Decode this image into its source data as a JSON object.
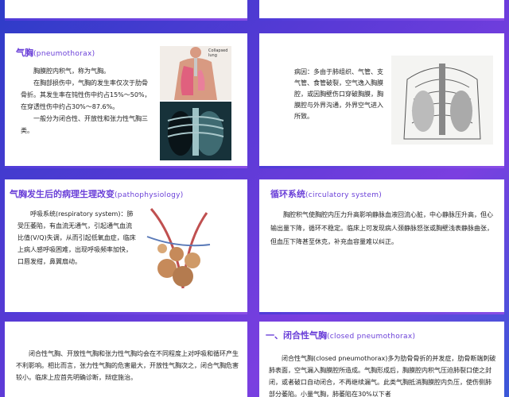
{
  "slide1": {
    "title_cn": "气胸",
    "title_en": "(pneumothorax)",
    "paragraphs": [
      "胸膜腔内积气，称为气胸。",
      "在胸部损伤中，气胸的发生率仅次于肋骨骨折。其发生率在钝性伤中约占15%～50%，在穿透性伤中约占30%～87.6%。",
      "一般分为闭合性、开放性和张力性气胸三类。"
    ],
    "figure_label": "Collapsed lung"
  },
  "slide2": {
    "text": "病因：多由于肺组织、气管、支气管、食管破裂，空气逸入胸膜腔，或因胸壁伤口穿破胸膜，胸膜腔与外界沟通，外界空气进入所致。"
  },
  "slide3": {
    "title_cn": "气胸发生后的病理生理改变",
    "title_en": "(pathophysiology)",
    "text": "呼吸系统(respiratory system)：肺受压萎陷，有血流无通气，引起通气血流比值(V/Q)失调，从而引起低氧血症，临床上病人感呼吸困难，出现呼吸频率加快，口唇发绀，鼻翼扇动。"
  },
  "slide4": {
    "title_cn": "循环系统",
    "title_en": "(circulatory system)",
    "text": "胸腔积气使胸腔内压力升高影响静脉血液回流心脏，中心静脉压升高，但心输出量下降，循环不稳定。临床上可发现病人颈静脉怒张或胸壁浅表静脉曲张，但血压下降甚至休克，补充血容量难以纠正。"
  },
  "slide5": {
    "text": "闭合性气胸、开放性气胸和张力性气胸均会在不同程度上对呼吸和循环产生不利影响。相比而言，张力性气胸的危害最大，开放性气胸次之，闭合气胸危害较小。临床上应首先明确诊断，辩症施治。"
  },
  "slide6": {
    "title_cn": "一、闭合性气胸",
    "title_en": "(closed pneumothorax)",
    "text": "闭合性气胸(closed pneumothorax)多为肋骨骨折的并发症，肋骨断端刺破肺表面，空气漏入胸膜腔所造成。气胸形成后，胸膜腔内积气压迫肺裂口使之封闭，或者破口自动闭合，不再继续漏气。此类气胸抵消胸膜腔内负压，使伤侧肺部分萎陷。小量气胸，肺萎陷在30%以下者"
  },
  "colors": {
    "accent": "#6a3fd8",
    "background_start": "#2d3cc8",
    "background_end": "#7b3fe0"
  }
}
